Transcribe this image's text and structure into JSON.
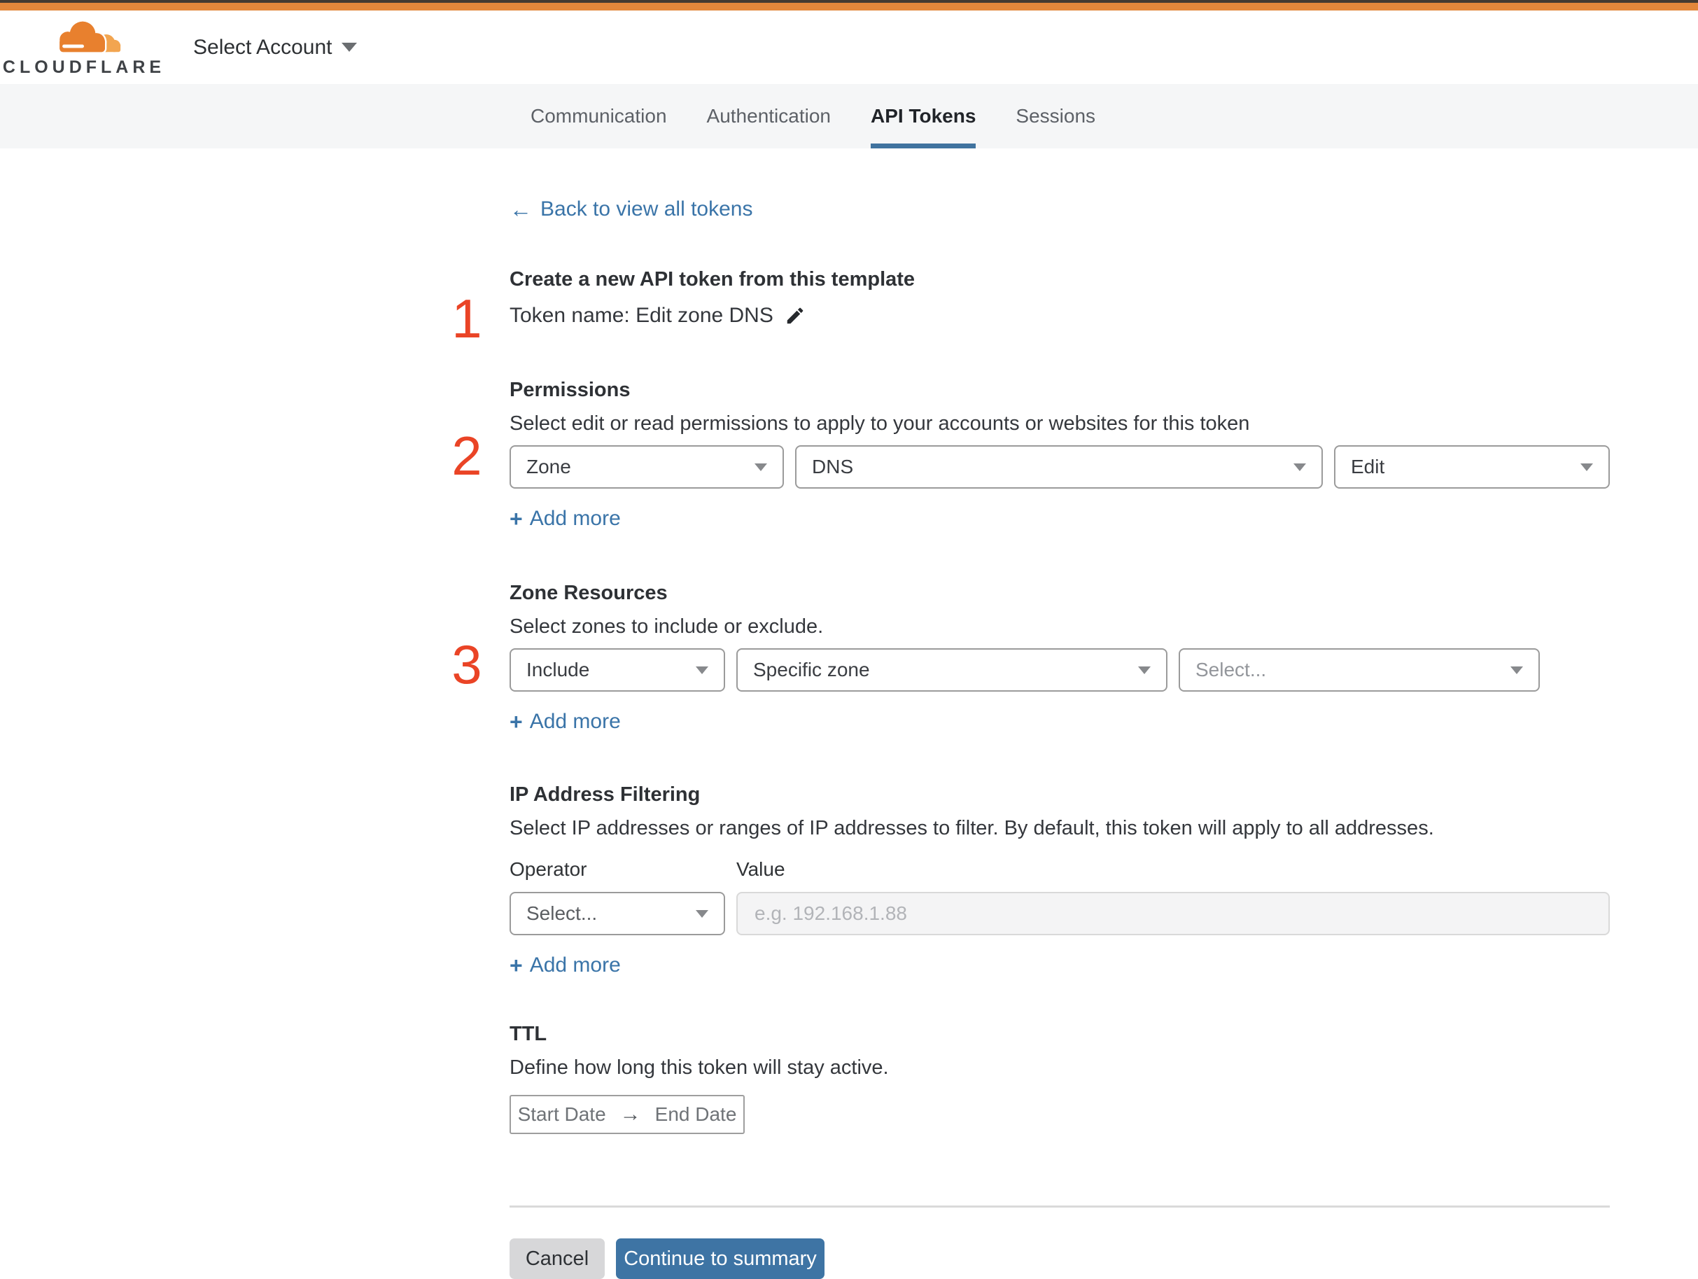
{
  "colors": {
    "accent_orange": "#e2873b",
    "brand_blue": "#3e74a4",
    "link_blue": "#3a74a8",
    "step_red": "#ea4426",
    "active_tab_underline": "#40739f"
  },
  "icons": {
    "back_arrow": "←",
    "plus": "+",
    "range_arrow": "→"
  },
  "header": {
    "logo_text": "CLOUDFLARE",
    "account_selector": "Select Account"
  },
  "tabs": [
    {
      "label": "Communication"
    },
    {
      "label": "Authentication"
    },
    {
      "label": "API Tokens"
    },
    {
      "label": "Sessions"
    }
  ],
  "active_tab": "API Tokens",
  "back_link": {
    "label": "Back to view all tokens"
  },
  "token_section": {
    "step": "1",
    "title": "Create a new API token from this template",
    "token_name": "Token name: Edit zone DNS"
  },
  "permissions": {
    "step": "2",
    "title": "Permissions",
    "description": "Select edit or read permissions to apply to your accounts or websites for this token",
    "scope_select": "Zone",
    "group_select": "DNS",
    "level_select": "Edit",
    "add_more": "Add more"
  },
  "zone_resources": {
    "step": "3",
    "title": "Zone Resources",
    "description": "Select zones to include or exclude.",
    "mode_select": "Include",
    "scope_select": "Specific zone",
    "zone_select_placeholder": "Select...",
    "add_more": "Add more"
  },
  "ip_filtering": {
    "title": "IP Address Filtering",
    "description": "Select IP addresses or ranges of IP addresses to filter. By default, this token will apply to all addresses.",
    "operator_label": "Operator",
    "value_label": "Value",
    "operator_placeholder": "Select...",
    "value_placeholder": "e.g. 192.168.1.88",
    "add_more": "Add more"
  },
  "ttl": {
    "title": "TTL",
    "description": "Define how long this token will stay active.",
    "start_label": "Start Date",
    "end_label": "End Date"
  },
  "footer": {
    "cancel_label": "Cancel",
    "continue_label": "Continue to summary"
  }
}
